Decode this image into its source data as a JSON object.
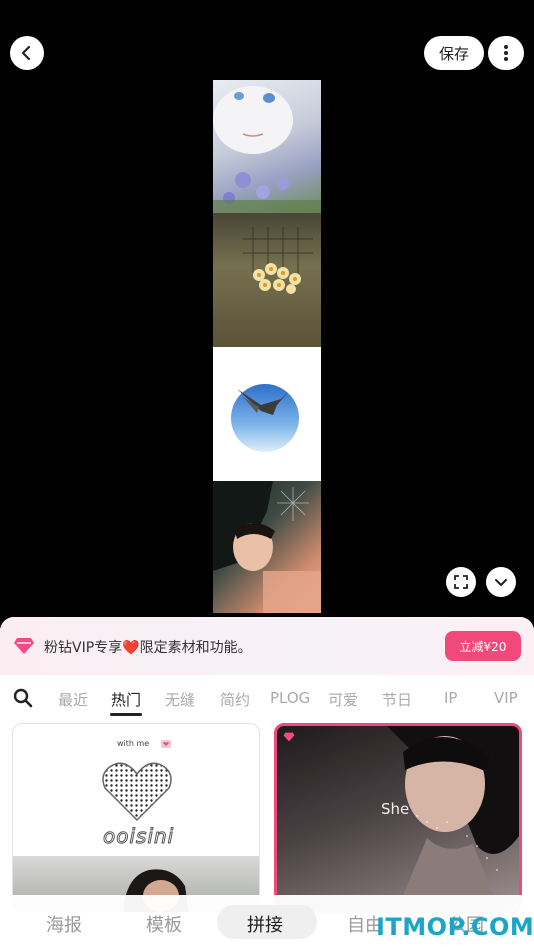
{
  "topbar": {
    "save_label": "保存"
  },
  "vip": {
    "text": "粉钻VIP专享❤️限定素材和功能。",
    "cta": "立减¥20"
  },
  "tabs": [
    "最近",
    "热门",
    "无缝",
    "简约",
    "PLOG",
    "可爱",
    "节日",
    "IP",
    "VIP"
  ],
  "active_tab": "热门",
  "cards": {
    "card1_heading": "with me",
    "card1_word": "ooisini",
    "card2_text": "She"
  },
  "bottom_nav": [
    "海报",
    "模板",
    "拼接",
    "自由",
    "公园"
  ],
  "watermark": "ITMOP.COM",
  "colors": {
    "accent_pink": "#f3487a",
    "card_border_pink": "#ef4a7c",
    "watermark_blue": "#1aa6c7"
  },
  "icons": {
    "back": "chevron-left-icon",
    "more": "more-vertical-icon",
    "crop": "crop-expand-icon",
    "collapse": "chevron-down-icon",
    "search": "search-icon",
    "vip": "pink-diamond-icon"
  }
}
